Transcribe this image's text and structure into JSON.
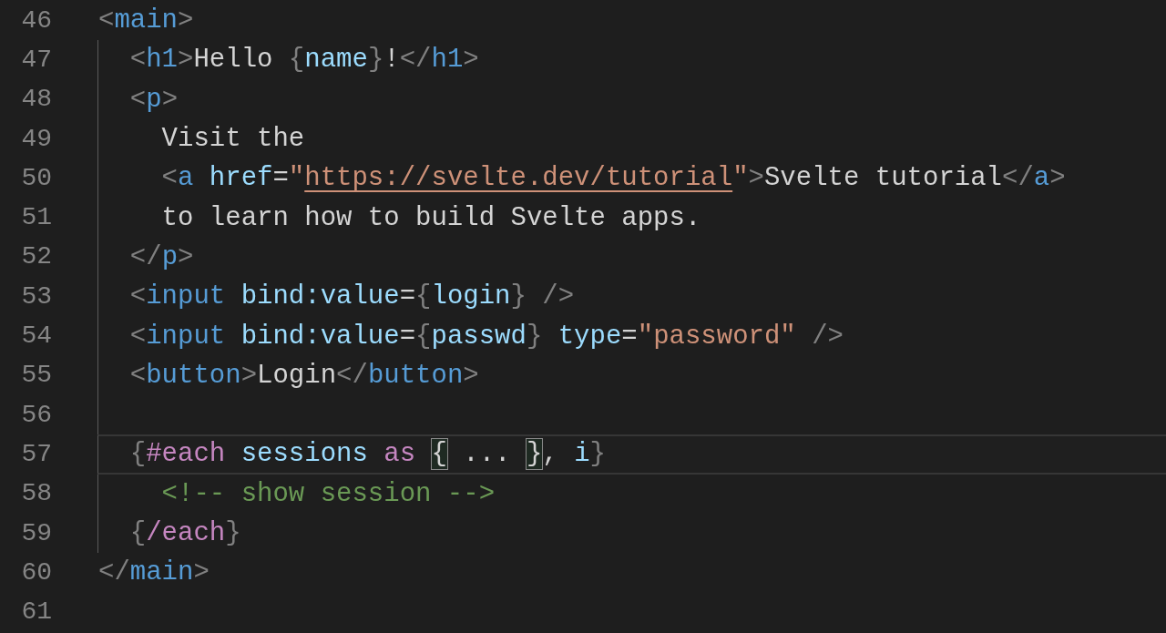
{
  "editor": {
    "lines": [
      {
        "number": "46",
        "guide": false,
        "current": false,
        "tokens": [
          {
            "kind": "punct",
            "text": "<"
          },
          {
            "kind": "tag",
            "text": "main"
          },
          {
            "kind": "punct",
            "text": ">"
          }
        ]
      },
      {
        "number": "47",
        "guide": true,
        "current": false,
        "tokens": [
          {
            "kind": "punct",
            "text": "  <"
          },
          {
            "kind": "tag",
            "text": "h1"
          },
          {
            "kind": "punct",
            "text": ">"
          },
          {
            "kind": "text",
            "text": "Hello "
          },
          {
            "kind": "punct",
            "text": "{"
          },
          {
            "kind": "var",
            "text": "name"
          },
          {
            "kind": "punct",
            "text": "}"
          },
          {
            "kind": "text",
            "text": "!"
          },
          {
            "kind": "punct",
            "text": "</"
          },
          {
            "kind": "tag",
            "text": "h1"
          },
          {
            "kind": "punct",
            "text": ">"
          }
        ]
      },
      {
        "number": "48",
        "guide": true,
        "current": false,
        "tokens": [
          {
            "kind": "punct",
            "text": "  <"
          },
          {
            "kind": "tag",
            "text": "p"
          },
          {
            "kind": "punct",
            "text": ">"
          }
        ]
      },
      {
        "number": "49",
        "guide": true,
        "current": false,
        "tokens": [
          {
            "kind": "text",
            "text": "    Visit the"
          }
        ]
      },
      {
        "number": "50",
        "guide": true,
        "current": false,
        "tokens": [
          {
            "kind": "punct",
            "text": "    <"
          },
          {
            "kind": "tag",
            "text": "a"
          },
          {
            "kind": "attr",
            "text": " href"
          },
          {
            "kind": "text",
            "text": "="
          },
          {
            "kind": "string",
            "text": "\""
          },
          {
            "kind": "link",
            "text": "https://svelte.dev/tutorial"
          },
          {
            "kind": "string",
            "text": "\""
          },
          {
            "kind": "punct",
            "text": ">"
          },
          {
            "kind": "text",
            "text": "Svelte tutorial"
          },
          {
            "kind": "punct",
            "text": "</"
          },
          {
            "kind": "tag",
            "text": "a"
          },
          {
            "kind": "punct",
            "text": ">"
          }
        ]
      },
      {
        "number": "51",
        "guide": true,
        "current": false,
        "tokens": [
          {
            "kind": "text",
            "text": "    to learn how to build Svelte apps."
          }
        ]
      },
      {
        "number": "52",
        "guide": true,
        "current": false,
        "tokens": [
          {
            "kind": "punct",
            "text": "  </"
          },
          {
            "kind": "tag",
            "text": "p"
          },
          {
            "kind": "punct",
            "text": ">"
          }
        ]
      },
      {
        "number": "53",
        "guide": true,
        "current": false,
        "tokens": [
          {
            "kind": "punct",
            "text": "  <"
          },
          {
            "kind": "tag",
            "text": "input"
          },
          {
            "kind": "attr",
            "text": " bind:value"
          },
          {
            "kind": "text",
            "text": "="
          },
          {
            "kind": "punct",
            "text": "{"
          },
          {
            "kind": "var",
            "text": "login"
          },
          {
            "kind": "punct",
            "text": "} />"
          }
        ]
      },
      {
        "number": "54",
        "guide": true,
        "current": false,
        "tokens": [
          {
            "kind": "punct",
            "text": "  <"
          },
          {
            "kind": "tag",
            "text": "input"
          },
          {
            "kind": "attr",
            "text": " bind:value"
          },
          {
            "kind": "text",
            "text": "="
          },
          {
            "kind": "punct",
            "text": "{"
          },
          {
            "kind": "var",
            "text": "passwd"
          },
          {
            "kind": "punct",
            "text": "}"
          },
          {
            "kind": "attr",
            "text": " type"
          },
          {
            "kind": "text",
            "text": "="
          },
          {
            "kind": "string",
            "text": "\"password\""
          },
          {
            "kind": "punct",
            "text": " />"
          }
        ]
      },
      {
        "number": "55",
        "guide": true,
        "current": false,
        "tokens": [
          {
            "kind": "punct",
            "text": "  <"
          },
          {
            "kind": "tag",
            "text": "button"
          },
          {
            "kind": "punct",
            "text": ">"
          },
          {
            "kind": "text",
            "text": "Login"
          },
          {
            "kind": "punct",
            "text": "</"
          },
          {
            "kind": "tag",
            "text": "button"
          },
          {
            "kind": "punct",
            "text": ">"
          }
        ]
      },
      {
        "number": "56",
        "guide": true,
        "current": false
      },
      {
        "number": "57",
        "guide": true,
        "current": true,
        "tokens": [
          {
            "kind": "punct",
            "text": "  {"
          },
          {
            "kind": "keyword",
            "text": "#each"
          },
          {
            "kind": "var",
            "text": " sessions"
          },
          {
            "kind": "keyword",
            "text": " as "
          },
          {
            "kind": "match",
            "text": "{"
          },
          {
            "kind": "text",
            "text": " ... "
          },
          {
            "kind": "match",
            "text": "}"
          },
          {
            "kind": "text",
            "text": ", "
          },
          {
            "kind": "var",
            "text": "i"
          },
          {
            "kind": "punct",
            "text": "}"
          }
        ]
      },
      {
        "number": "58",
        "guide": true,
        "current": false,
        "tokens": [
          {
            "kind": "comment",
            "text": "    <!-- show session -->"
          }
        ]
      },
      {
        "number": "59",
        "guide": true,
        "current": false,
        "tokens": [
          {
            "kind": "punct",
            "text": "  {"
          },
          {
            "kind": "keyword",
            "text": "/each"
          },
          {
            "kind": "punct",
            "text": "}"
          }
        ]
      },
      {
        "number": "60",
        "guide": false,
        "current": false,
        "tokens": [
          {
            "kind": "punct",
            "text": "</"
          },
          {
            "kind": "tag",
            "text": "main"
          },
          {
            "kind": "punct",
            "text": ">"
          }
        ]
      },
      {
        "number": "61",
        "guide": false,
        "current": false
      }
    ]
  }
}
